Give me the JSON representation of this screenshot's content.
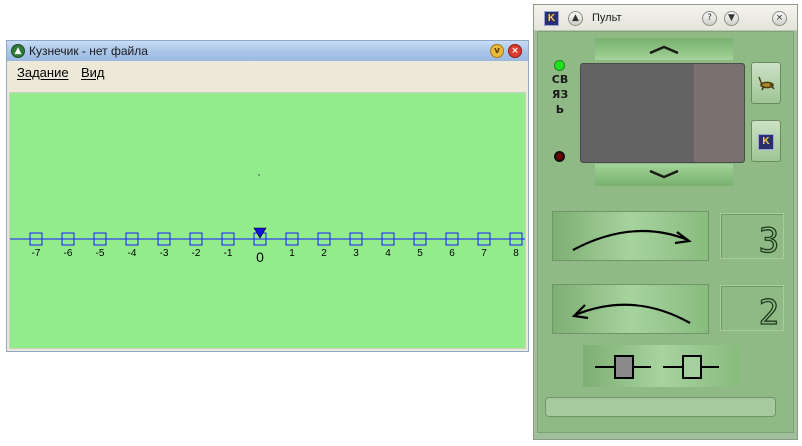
{
  "left_window": {
    "title": "Кузнечик - нет файла",
    "app_icon": "chevron-up-icon",
    "minimize_glyph": "v",
    "close_glyph": "×",
    "menu": [
      "Задание",
      "Вид"
    ]
  },
  "number_line": {
    "ticks": [
      "-7",
      "-6",
      "-5",
      "-4",
      "-3",
      "-2",
      "-1",
      "0",
      "1",
      "2",
      "3",
      "4",
      "5",
      "6",
      "7",
      "8"
    ],
    "grasshopper_position": "0",
    "line_color": "#1a1aff",
    "canvas_color": "#92ec8c"
  },
  "right_window": {
    "title": "Пульт",
    "k_label": "K",
    "side_label": "СВЯЗЬ",
    "command_forward_value": "3",
    "command_back_value": "2",
    "icons": {
      "help": "question-icon",
      "collapse": "chevron-down-icon",
      "close": "close-icon",
      "grasshopper": "grasshopper-icon"
    }
  }
}
